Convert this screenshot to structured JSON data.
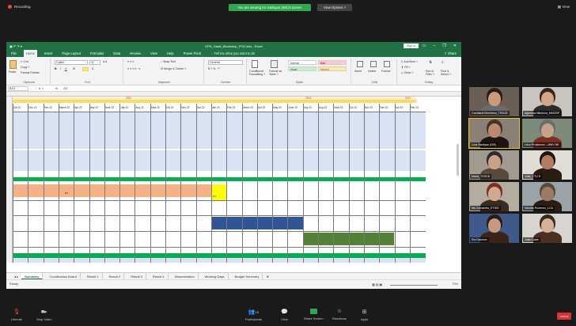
{
  "zoom": {
    "recording_label": "Recording",
    "banner": "You are viewing Ivo Sarkiyan (BIS)'s screen",
    "view_options": "View Options ˅",
    "view_button": "View"
  },
  "excel": {
    "title": "KPS_Gantt_Workshop_PCD.xlsx  -  Excel",
    "sign_in": "Sign in",
    "tabs": [
      "File",
      "Home",
      "Insert",
      "Page Layout",
      "Formulas",
      "Data",
      "Review",
      "View",
      "Help",
      "Power Pivot"
    ],
    "active_tab": "Home",
    "tell_me": "Tell me what you want to do",
    "share": "Share",
    "ribbon": {
      "clipboard": {
        "label": "Clipboard",
        "paste": "Paste",
        "cut": "Cut",
        "copy": "Copy ˅",
        "format_painter": "Format Painter"
      },
      "font": {
        "label": "Font",
        "font_name": "Calibri",
        "font_size": "11"
      },
      "alignment": {
        "label": "Alignment",
        "wrap": "Wrap Text",
        "merge": "Merge & Center ˅"
      },
      "number": {
        "label": "Number",
        "format": "General"
      },
      "styles": {
        "label": "Styles",
        "conditional": "Conditional Formatting ˅",
        "format_table": "Format as Table ˅",
        "normal": "Normal",
        "bad": "Bad",
        "good": "Good",
        "neutral": "Neutral"
      },
      "cells": {
        "label": "Cells",
        "insert": "Insert",
        "delete": "Delete",
        "format": "Format"
      },
      "editing": {
        "label": "Editing",
        "autosum": "AutoSum ˅",
        "fill": "Fill ˅",
        "clear": "Clear ˅",
        "sort": "Sort & Filter ˅",
        "find": "Find & Select ˅"
      }
    },
    "name_box": "B15",
    "fx": "fx",
    "formula_value": "2/2",
    "years": [
      "2022",
      "2023",
      "2024"
    ],
    "months": [
      "Oct 21",
      "Dec 21",
      "Feb 22",
      "March 22",
      "Apr 22",
      "May 22",
      "June 22",
      "July 22",
      "Aug 22",
      "Sept 22",
      "Oct 22",
      "Nov 22",
      "Dec 22",
      "Jan 23",
      "Feb 23",
      "March 23",
      "Apr 23",
      "May 23",
      "June 23",
      "July 23",
      "Aug 23",
      "Sept 23",
      "Oct 23",
      "Nov 23",
      "Dec 23",
      "Jan 24",
      "Feb 24"
    ],
    "sheet_tabs": [
      "Summary",
      "Coordination Board",
      "Result 1",
      "Result 2",
      "Result 3",
      "Result 4",
      "Dissemination",
      "Working Days",
      "Budget Summary"
    ],
    "active_sheet": "Summary",
    "status": "Ready",
    "zoom_level": "70%",
    "cell_marks": [
      "M1",
      "M1"
    ],
    "colors": {
      "excel_green": "#217346",
      "lightblue": "#dae3f3",
      "salmon": "#f4b183",
      "yellow": "#ffff00",
      "blue": "#2f5597",
      "olive": "#548235",
      "green": "#00b050",
      "orange": "#ffc000"
    }
  },
  "participants": [
    {
      "name": "Caroliana Bercheva_TSSCB"
    },
    {
      "name": "Agnessa Nikolova_MMCBP"
    },
    {
      "name": "Lora Sarkiyan (BIS)"
    },
    {
      "name": "Libor Proskovec - UNIV NE"
    },
    {
      "name": "Maria_TSSCB"
    },
    {
      "name": "Julia_CTU.R"
    },
    {
      "name": "Iris Comaneiu_ETSIS"
    },
    {
      "name": "Nicolas Rozenov_LCA"
    },
    {
      "name": "Ela Daomov"
    },
    {
      "name": "Julia Coale"
    }
  ],
  "toolbar": {
    "unmute": "Unmute",
    "stop_video": "Stop Video",
    "participants": "Participants",
    "participants_count": "15",
    "chat": "Chat",
    "share_screen": "Share Screen",
    "reactions": "Reactions",
    "apps": "Apps",
    "leave": "Leave"
  }
}
